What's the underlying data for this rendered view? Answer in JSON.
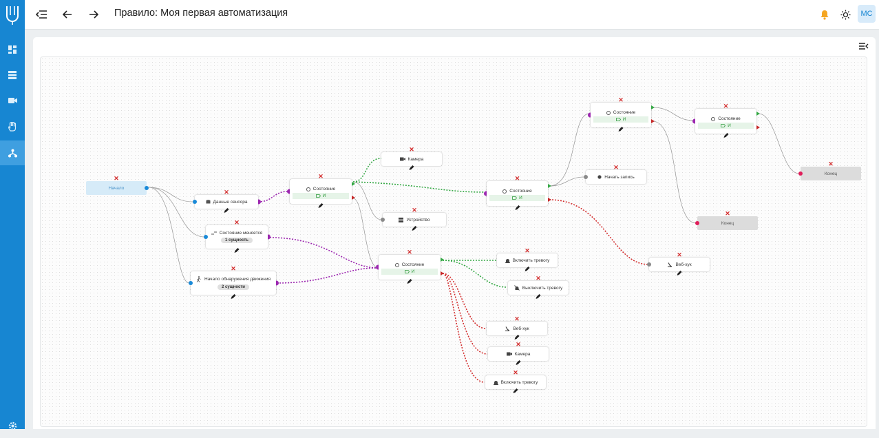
{
  "header": {
    "title": "Правило: Моя первая автоматизация",
    "avatar": "MC"
  },
  "icons": [
    "app-logo-icon",
    "dashboard-icon",
    "sensors-icon",
    "camera-icon",
    "hand-icon",
    "automation-icon",
    "settings-icon",
    "collapse-sidebar-icon",
    "back-arrow-icon",
    "forward-arrow-icon",
    "bell-icon",
    "brightness-icon",
    "panel-toggle-icon"
  ],
  "colors": {
    "accent": "#1786d2",
    "true_branch": "#35a845",
    "false_branch": "#c62828",
    "link": "#9c27b0",
    "notification": "#f5a623"
  },
  "flow": {
    "start": "Начало",
    "sensor_data": "Данные сенсора",
    "state_changes": "Состояние меняется",
    "state_changes_count": "1 сущность",
    "motion_start": "Начало обнаружения движения",
    "motion_count": "2 сущности",
    "cond1": {
      "title": "Состояние",
      "op": "И"
    },
    "cond2": {
      "title": "Состояние",
      "op": "И"
    },
    "cond3": {
      "title": "Состояние",
      "op": "И"
    },
    "cond4": {
      "title": "Состояние",
      "op": "И"
    },
    "cond5": {
      "title": "Состояние",
      "op": "И"
    },
    "camera1": "Камера",
    "device": "Устройство",
    "start_recording": "Начать запись",
    "end1": "Конец",
    "end2": "Конец",
    "webhook1": "Веб-хук",
    "alarm_on1": "Включить тревогу",
    "alarm_off": "Выключить тревогу",
    "webhook2": "Веб-хук",
    "camera2": "Камера",
    "alarm_on2": "Включить тревогу"
  }
}
